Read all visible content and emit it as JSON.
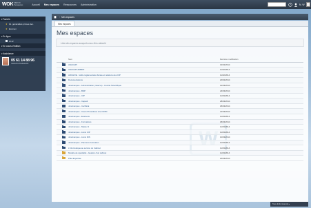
{
  "app": {
    "logo": "WOK",
    "logo_sub": "WEB OK Pessageries",
    "nav": [
      "Accueil",
      "Mes espaces",
      "Ressources",
      "Administration"
    ],
    "user_label": "N. W"
  },
  "sidebar": {
    "sections": [
      {
        "title": "Favoris",
        "items": [
          "01. généralités primes dec.",
          "Examen"
        ]
      },
      {
        "title": "En ligne",
        "items": [
          "W-W"
        ]
      },
      {
        "title": "En cours d'édition",
        "items": []
      },
      {
        "title": "Assistance",
        "items": []
      }
    ],
    "contact": {
      "phone": "05 61 14 88 96",
      "name": "Catherine Fraissinette"
    }
  },
  "breadcrumb": {
    "items": [
      "Mes espaces"
    ]
  },
  "main": {
    "tab": "Mes espaces",
    "title": "Mes espaces",
    "intro": "Liste des espaces auxquels vous êtes rattaché",
    "columns": {
      "name": "Nom",
      "date": "Dernière modification"
    },
    "rows": [
      {
        "name": "ANACAPI",
        "date": "13/02/2014",
        "open": false
      },
      {
        "name": "ANACAPI ADBDP",
        "date": "11/02/2014",
        "open": false
      },
      {
        "name": "ARCHIVE - Veille réglementaire fiscale et relations des CIP",
        "date": "11/02/2014",
        "open": false
      },
      {
        "name": "Documentations",
        "date": "20/02/2014",
        "open": false
      },
      {
        "name": "JuraCampus - Administration (réservé) - Comité Scientifique",
        "date": "12/03/2014",
        "open": false
      },
      {
        "name": "JuraCampus - BNP",
        "date": "24/03/2014",
        "open": false
      },
      {
        "name": "JuraCampus - CIP",
        "date": "11/03/2014",
        "open": false
      },
      {
        "name": "JuraCampus - Capadi",
        "date": "28/03/2014",
        "open": false
      },
      {
        "name": "JuraCampus - Certificat",
        "date": "18/03/2014",
        "open": false
      },
      {
        "name": "JuraCampus - Cours Procédures à la CDPC",
        "date": "21/03/2014",
        "open": false
      },
      {
        "name": "JuraCampus - Examens",
        "date": "11/03/2014",
        "open": false
      },
      {
        "name": "JuraCampus - Formations",
        "date": "18/03/2014",
        "open": false
      },
      {
        "name": "JuraCampus - Master 2",
        "date": "11/03/2014",
        "open": false
      },
      {
        "name": "JuraCampus - Livret CIP",
        "date": "11/03/2014",
        "open": false
      },
      {
        "name": "JuraCampus - Livret DIS",
        "date": "10/03/2014",
        "open": false
      },
      {
        "name": "JuraCampus - Parcours Formation",
        "date": "11/03/2014",
        "open": false
      },
      {
        "name": "L'informatique au service du Cabinet",
        "date": "11/03/2014",
        "open": false
      },
      {
        "name": "Modèle de spécialité - Gestion d'un cabinet",
        "date": "11/03/2014",
        "open": true
      },
      {
        "name": "Pôle Expertise",
        "date": "20/03/2014",
        "open": true
      }
    ]
  },
  "footer": {
    "label": "Tous droits réservés ▸"
  },
  "colors": {
    "topbar": "#2a3644",
    "accent": "#2c4a73",
    "link": "#2c5a8c"
  }
}
